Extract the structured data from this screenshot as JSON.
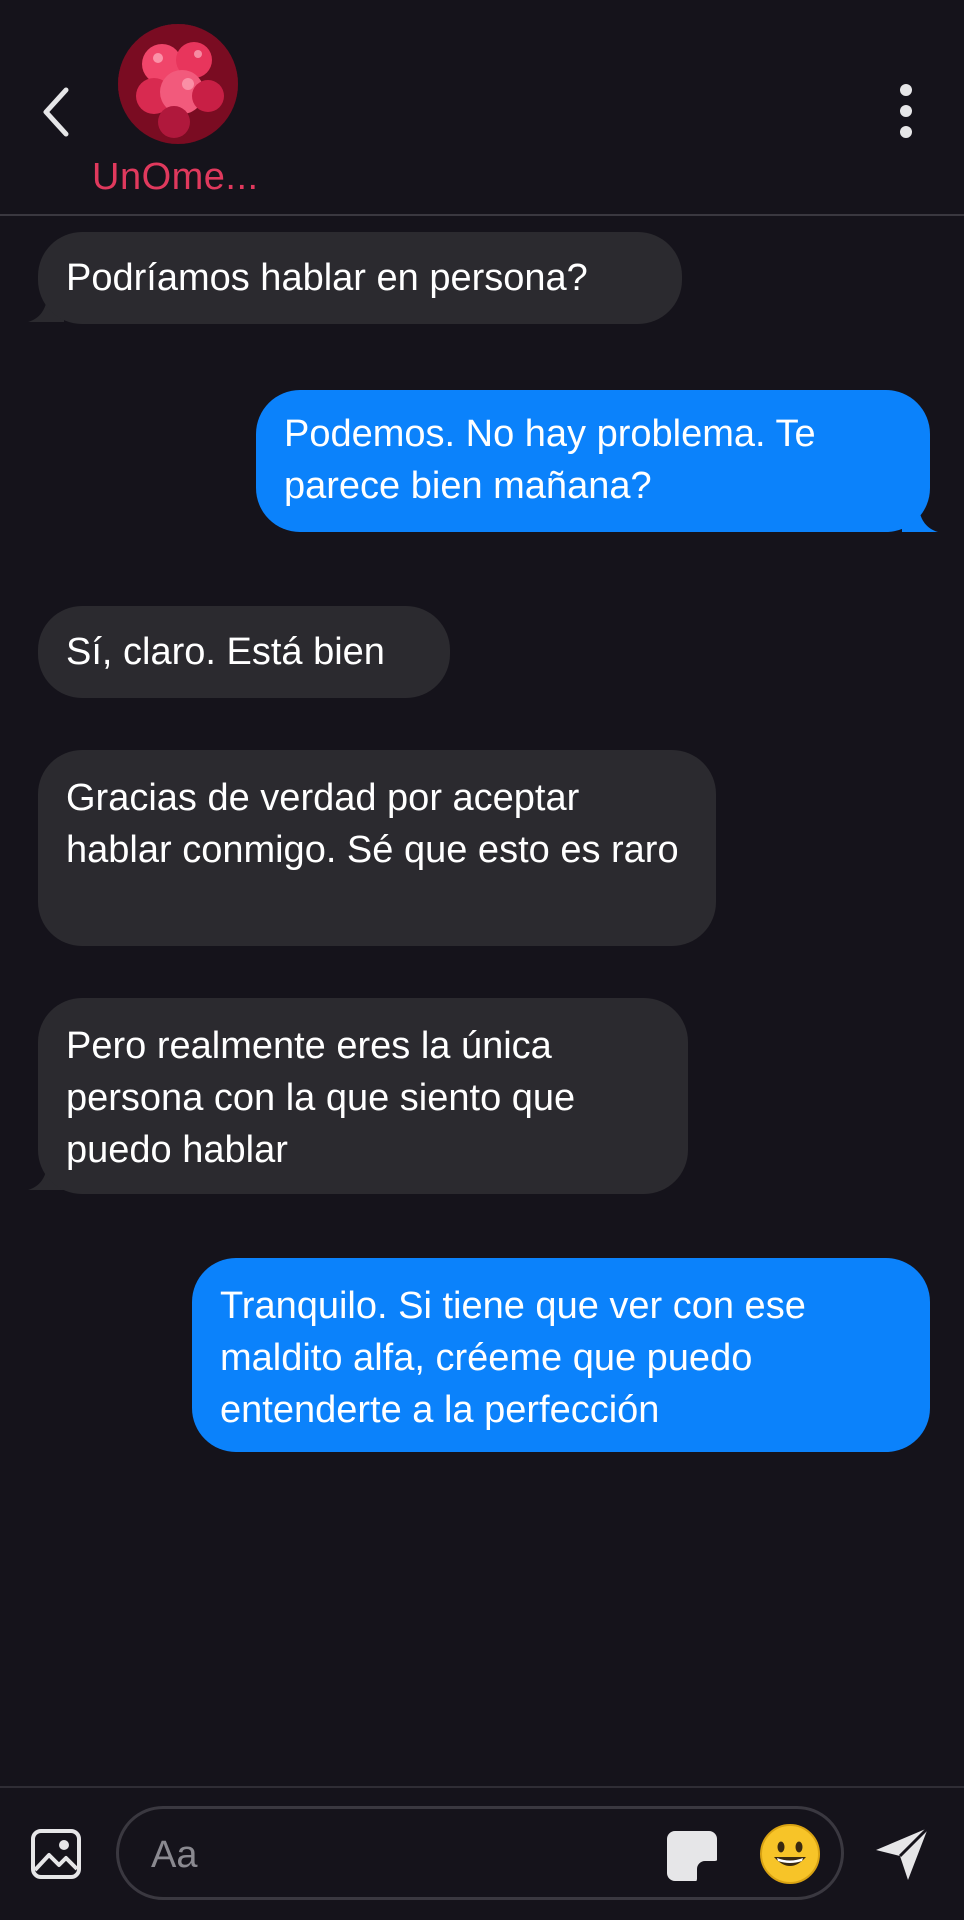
{
  "header": {
    "contact_name": "UnOme..."
  },
  "messages": [
    {
      "direction": "incoming",
      "text": "Podríamos hablar en persona?"
    },
    {
      "direction": "outgoing",
      "text": "Podemos. No hay problema. Te parece bien mañana?"
    },
    {
      "direction": "incoming",
      "text": "Sí, claro. Está bien"
    },
    {
      "direction": "incoming",
      "text": "Gracias de verdad por aceptar hablar conmigo. Sé que esto es raro"
    },
    {
      "direction": "incoming",
      "text": "Pero realmente eres la única persona con la que siento que puedo hablar"
    },
    {
      "direction": "outgoing",
      "text": "Tranquilo. Si tiene que ver con ese maldito alfa, créeme que puedo entenderte a la perfección"
    }
  ],
  "composer": {
    "placeholder": "Aa"
  },
  "colors": {
    "background": "#15131b",
    "incoming_bubble": "#2b2a2f",
    "outgoing_bubble": "#0b82fb",
    "contact_name": "#e0395d"
  },
  "icons": {
    "back": "chevron-left-icon",
    "more": "more-vertical-icon",
    "gallery": "image-icon",
    "sticker": "sticker-icon",
    "emoji": "emoji-icon",
    "send": "send-icon"
  }
}
